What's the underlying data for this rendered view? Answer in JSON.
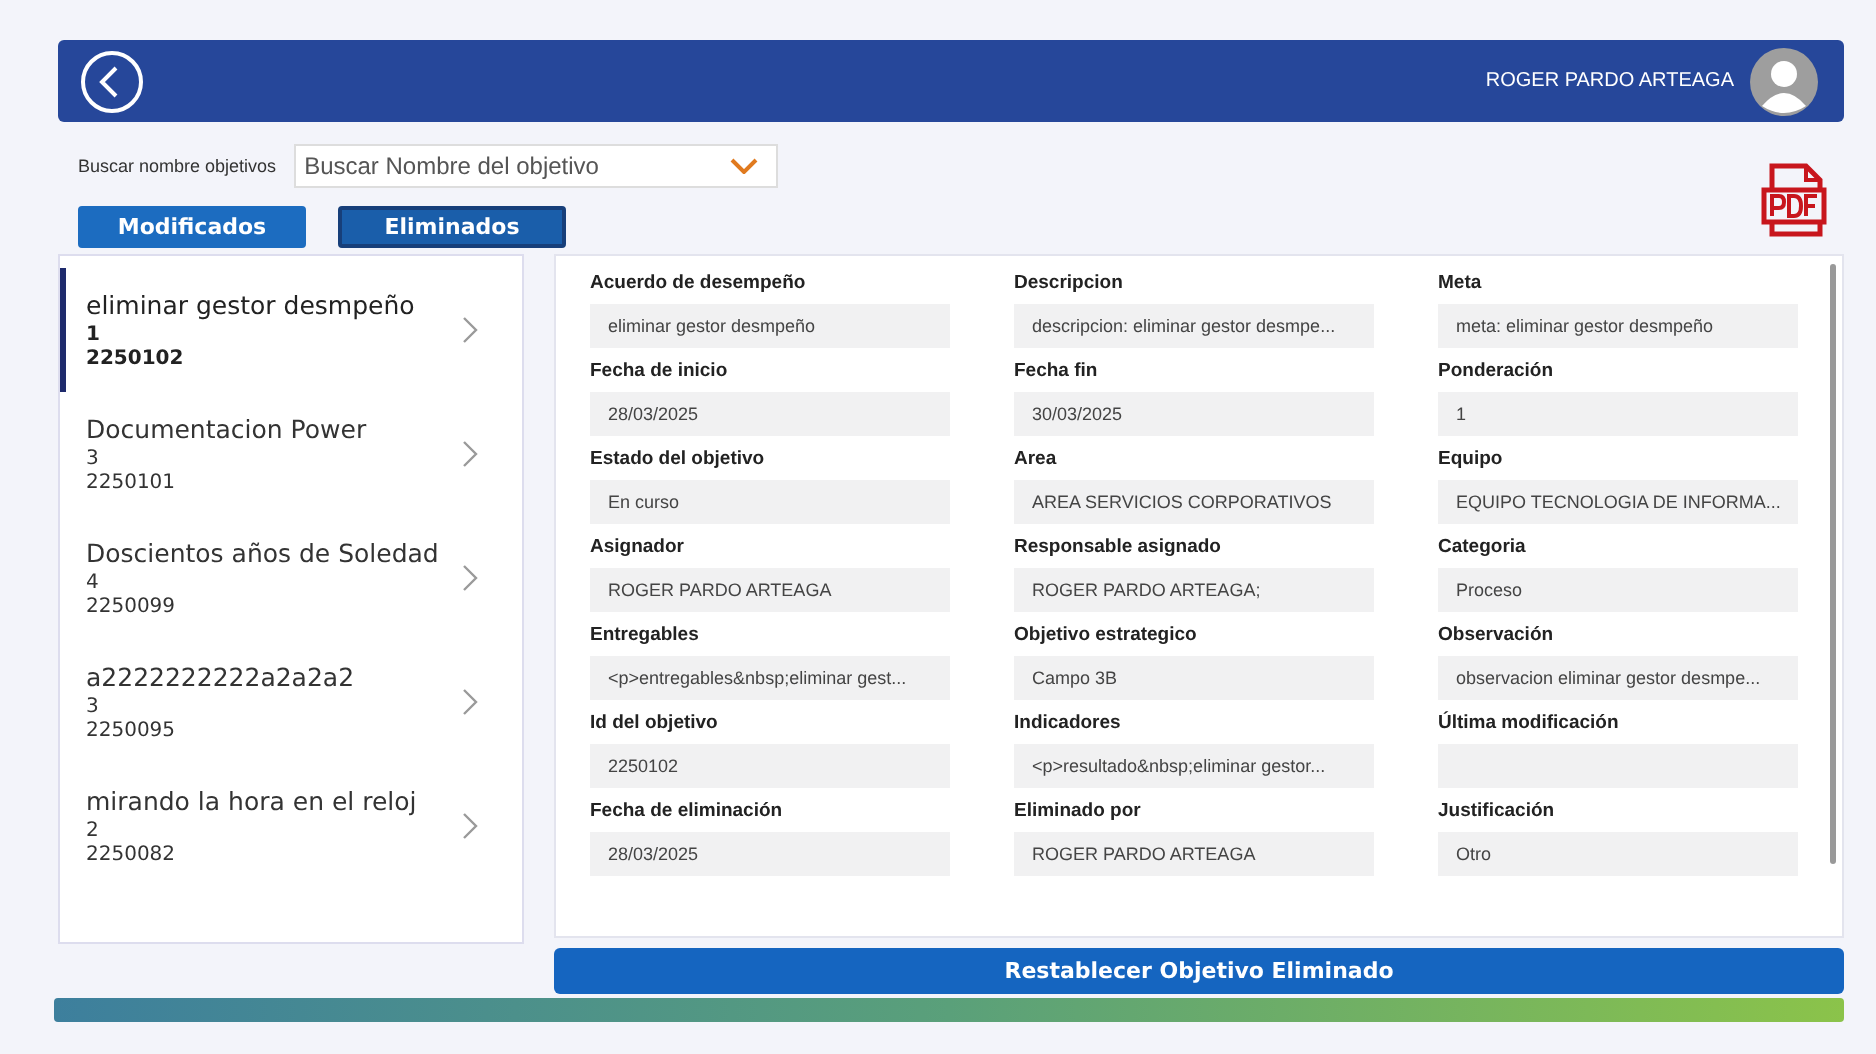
{
  "header": {
    "user_name": "ROGER PARDO ARTEAGA"
  },
  "search": {
    "label": "Buscar nombre objetivos",
    "placeholder": "Buscar Nombre del objetivo"
  },
  "tabs": [
    {
      "label": "Modificados",
      "selected": false
    },
    {
      "label": "Eliminados",
      "selected": true
    }
  ],
  "objectives": [
    {
      "name": "eliminar gestor desmpeño",
      "number": "1",
      "id": "2250102",
      "selected": true
    },
    {
      "name": "Documentacion Power",
      "number": "3",
      "id": "2250101",
      "selected": false
    },
    {
      "name": "Doscientos años de Soledad",
      "number": "4",
      "id": "2250099",
      "selected": false
    },
    {
      "name": "a2222222222a2a2a2",
      "number": "3",
      "id": "2250095",
      "selected": false
    },
    {
      "name": "mirando la hora en el reloj",
      "number": "2",
      "id": "2250082",
      "selected": false
    }
  ],
  "details": [
    {
      "label": "Acuerdo de desempeño",
      "value": "eliminar gestor desmpeño"
    },
    {
      "label": "Descripcion",
      "value": "descripcion: eliminar gestor desmpe..."
    },
    {
      "label": "Meta",
      "value": "meta: eliminar gestor desmpeño"
    },
    {
      "label": "Fecha de inicio",
      "value": "28/03/2025"
    },
    {
      "label": "Fecha fin",
      "value": "30/03/2025"
    },
    {
      "label": "Ponderación",
      "value": "1"
    },
    {
      "label": "Estado del objetivo",
      "value": "En curso"
    },
    {
      "label": "Area",
      "value": "AREA SERVICIOS CORPORATIVOS"
    },
    {
      "label": "Equipo",
      "value": "EQUIPO TECNOLOGIA DE INFORMA..."
    },
    {
      "label": "Asignador",
      "value": "ROGER PARDO ARTEAGA"
    },
    {
      "label": "Responsable asignado",
      "value": "ROGER PARDO ARTEAGA;"
    },
    {
      "label": "Categoria",
      "value": "Proceso"
    },
    {
      "label": "Entregables",
      "value": "<p>entregables&nbsp;eliminar gest..."
    },
    {
      "label": "Objetivo estrategico",
      "value": "Campo 3B"
    },
    {
      "label": "Observación",
      "value": "observacion eliminar gestor desmpe..."
    },
    {
      "label": "Id del objetivo",
      "value": "2250102"
    },
    {
      "label": "Indicadores",
      "value": "<p>resultado&nbsp;eliminar gestor..."
    },
    {
      "label": "Última modificación"
    },
    {
      "label": "Fecha de eliminación",
      "value": "28/03/2025"
    },
    {
      "label": "Eliminado por",
      "value": "ROGER PARDO ARTEAGA"
    },
    {
      "label": "Justificación",
      "value": "Otro"
    }
  ],
  "restore_button": "Restablecer Objetivo Eliminado"
}
